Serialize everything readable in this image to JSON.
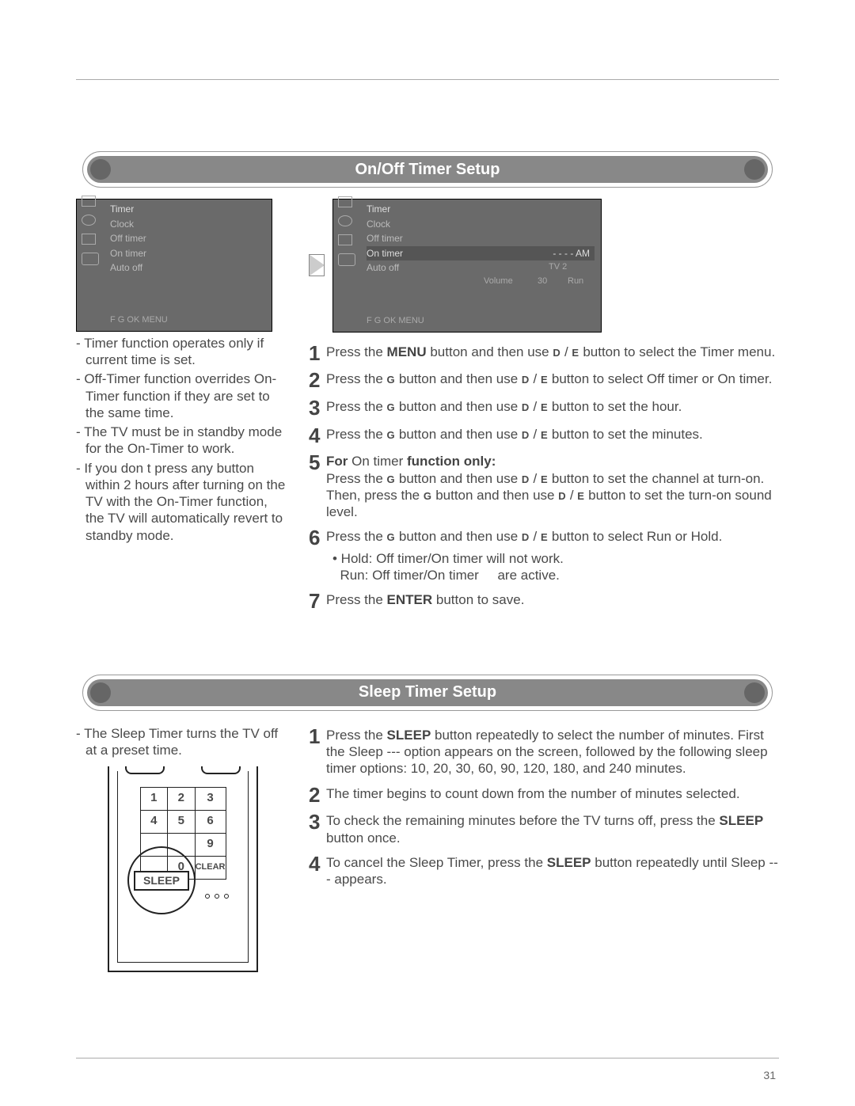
{
  "page_number": "31",
  "section1": {
    "title": "On/Off Timer Setup",
    "osd_left": {
      "title": "Timer",
      "items": [
        "Clock",
        "Off timer",
        "On timer",
        "Auto off"
      ],
      "footer": "F G   OK  MENU"
    },
    "osd_right": {
      "title": "Timer",
      "items": [
        "Clock",
        "Off timer"
      ],
      "selected": "On timer",
      "after_sel": "Auto off",
      "col2_line1": "- -  - -    AM",
      "col2_line2a": "TV 2",
      "col2_line3a": "Volume",
      "col2_line3b": "30",
      "col2_line3c": "Run",
      "footer": "F G   OK  MENU"
    },
    "notes": [
      "Timer function operates only if current time is set.",
      "Off-Timer function overrides On-Timer function if they are set to the same time.",
      "The TV must be in standby mode for the On-Timer to work.",
      "If you don t press any button within 2 hours after turning on the TV with the On-Timer function, the TV will automatically revert to standby mode."
    ],
    "steps": {
      "s1a": "Press the ",
      "s1b": "MENU",
      "s1c": " button and then use ",
      "s1d": "D",
      "s1e": " / ",
      "s1f": "E",
      "s1g": "  button to select the Timer menu.",
      "s2a": "Press the ",
      "s2b": "G",
      "s2c": "  button and then use ",
      "s2d": "D",
      "s2e": " / ",
      "s2f": "E",
      "s2g": " button to select Off timer   or On timer.",
      "s3a": "Press the ",
      "s3b": "G",
      "s3c": "  button and then use ",
      "s3d": "D",
      "s3e": " / ",
      "s3f": "E",
      "s3g": " button to set the hour.",
      "s4a": "Press the ",
      "s4b": "G",
      "s4c": "  button and then use ",
      "s4d": "D",
      "s4e": " / ",
      "s4f": "E",
      "s4g": " button to set the minutes.",
      "s5h": "For",
      "s5i": " On timer ",
      "s5j": " function only:",
      "s5a": "Press the ",
      "s5b": "G",
      "s5c": "  button and then use ",
      "s5d": "D",
      "s5e": " / ",
      "s5f": "E",
      "s5g": "  button to set the channel at turn-on. Then, press the ",
      "s5k": "G",
      "s5l": "  button and then use ",
      "s5m": "D",
      "s5n": " / ",
      "s5o": "E",
      "s5p": "  button to set the turn-on sound level.",
      "s6a": "Press the ",
      "s6b": "G",
      "s6c": "  button and then use ",
      "s6d": "D",
      "s6e": " / ",
      "s6f": "E",
      "s6g": "  button to select Run or Hold.",
      "s6sub1": "• Hold: Off timer/On timer      will not work.",
      "s6sub2": "  Run: Off timer/On timer     are active.",
      "s7a": "Press the ",
      "s7b": "ENTER",
      "s7c": " button to save."
    }
  },
  "section2": {
    "title": "Sleep Timer Setup",
    "notes": [
      "The Sleep Timer turns the TV off at a preset time."
    ],
    "remote": {
      "k1": "1",
      "k2": "2",
      "k3": "3",
      "k4": "4",
      "k5": "5",
      "k6": "6",
      "k7": "",
      "k8": "",
      "k9": "9",
      "k0": "0",
      "kclear": "CLEAR",
      "sleep": "SLEEP"
    },
    "steps": {
      "s1a": "Press the ",
      "s1b": "SLEEP",
      "s1c": " button repeatedly to select the number of minutes. First the Sleep --- option appears on the screen, followed by the following sleep timer options: 10, 20, 30, 60, 90, 120, 180, and 240 minutes.",
      "s2": "The timer begins to count down from the number of minutes selected.",
      "s3a": "To check the remaining minutes before the TV turns off, press the ",
      "s3b": "SLEEP",
      "s3c": " button once.",
      "s4a": "To cancel the Sleep Timer, press the ",
      "s4b": "SLEEP",
      "s4c": " button repeatedly until Sleep --- appears."
    }
  }
}
